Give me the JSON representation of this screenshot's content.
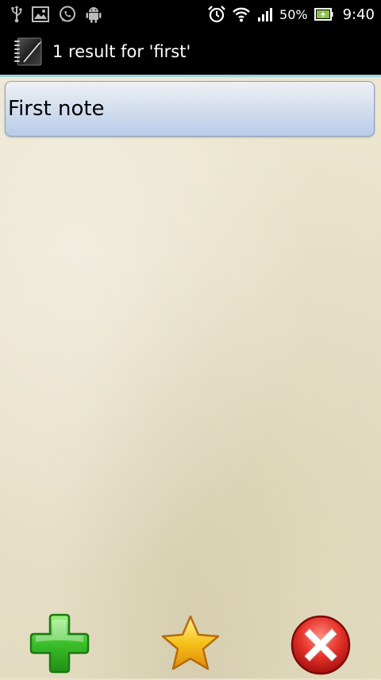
{
  "status_bar": {
    "left_icons": [
      "usb-icon",
      "image-icon",
      "whatsapp-icon",
      "android-icon"
    ],
    "right_icons": [
      "alarm-icon",
      "wifi-icon",
      "signal-icon",
      "battery-icon"
    ],
    "battery_percent": "50%",
    "time": "9:40"
  },
  "action_bar": {
    "title": "1 result for 'first'"
  },
  "results": [
    {
      "title": "First note"
    }
  ],
  "toolbar": {
    "add_icon": "plus-icon",
    "favorite_icon": "star-icon",
    "close_icon": "close-icon"
  },
  "colors": {
    "accent_line": "#9ed3e0",
    "item_highlight": "#b8cbe9",
    "add_green": "#3cbf2a",
    "star_yellow": "#f6c21a",
    "close_red": "#d81f1f"
  }
}
